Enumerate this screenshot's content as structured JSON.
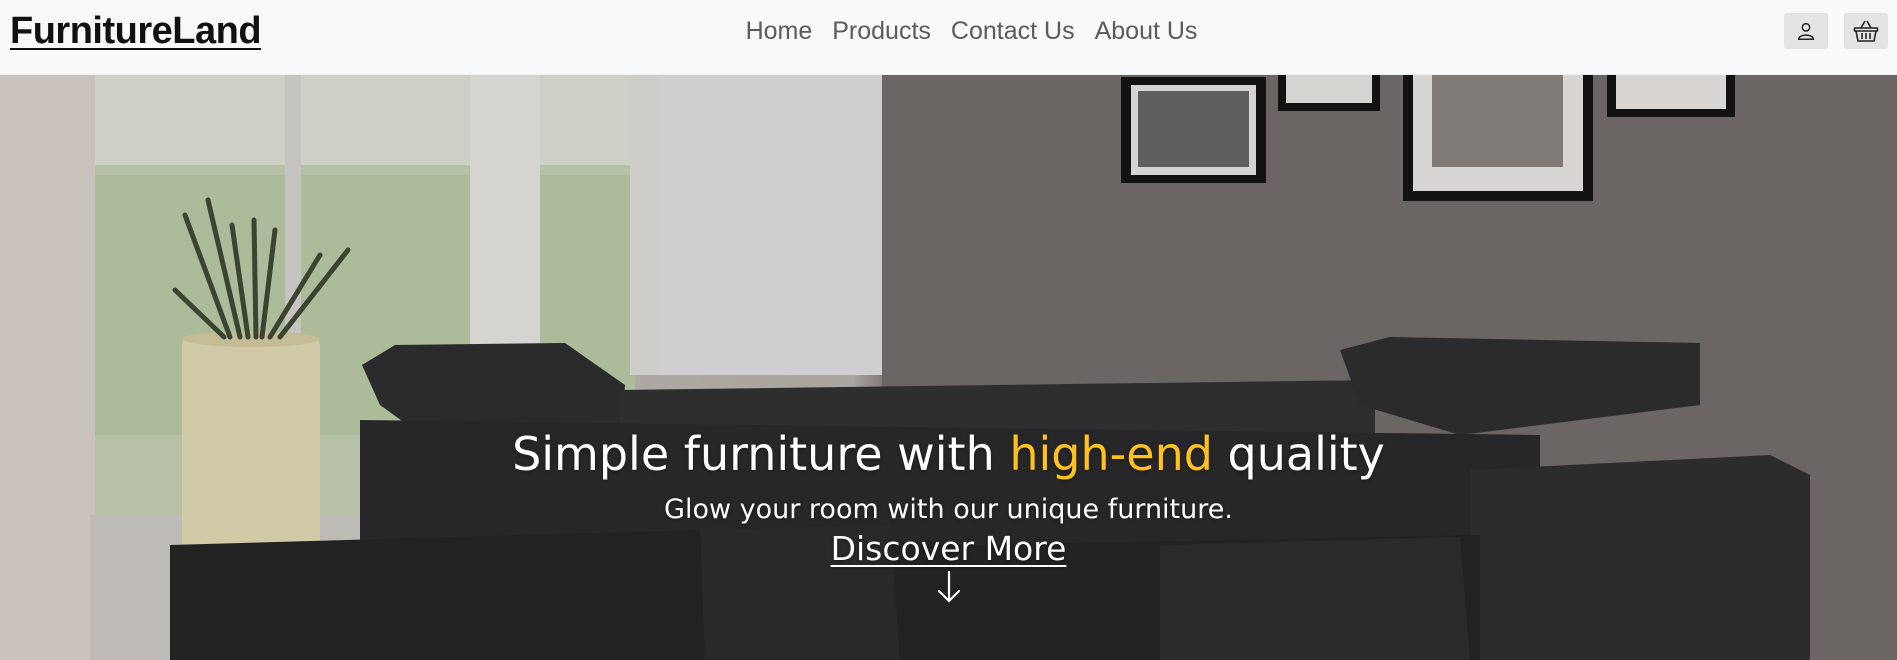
{
  "brand": {
    "name": "FurnitureLand"
  },
  "nav": {
    "links": [
      {
        "label": "Home"
      },
      {
        "label": "Products"
      },
      {
        "label": "Contact Us"
      },
      {
        "label": "About Us"
      }
    ],
    "icons": {
      "account": "user-icon",
      "cart": "basket-icon"
    }
  },
  "hero": {
    "headline_pre": "Simple furniture with",
    "headline_accent": "high-end",
    "headline_post": "quality",
    "subtitle": "Glow your room with our unique furniture.",
    "cta_label": "Discover More",
    "cta_icon": "arrow-down-icon",
    "accent_color": "#ffc11f",
    "background": "photo of dark leather sectional sofa in living room"
  }
}
